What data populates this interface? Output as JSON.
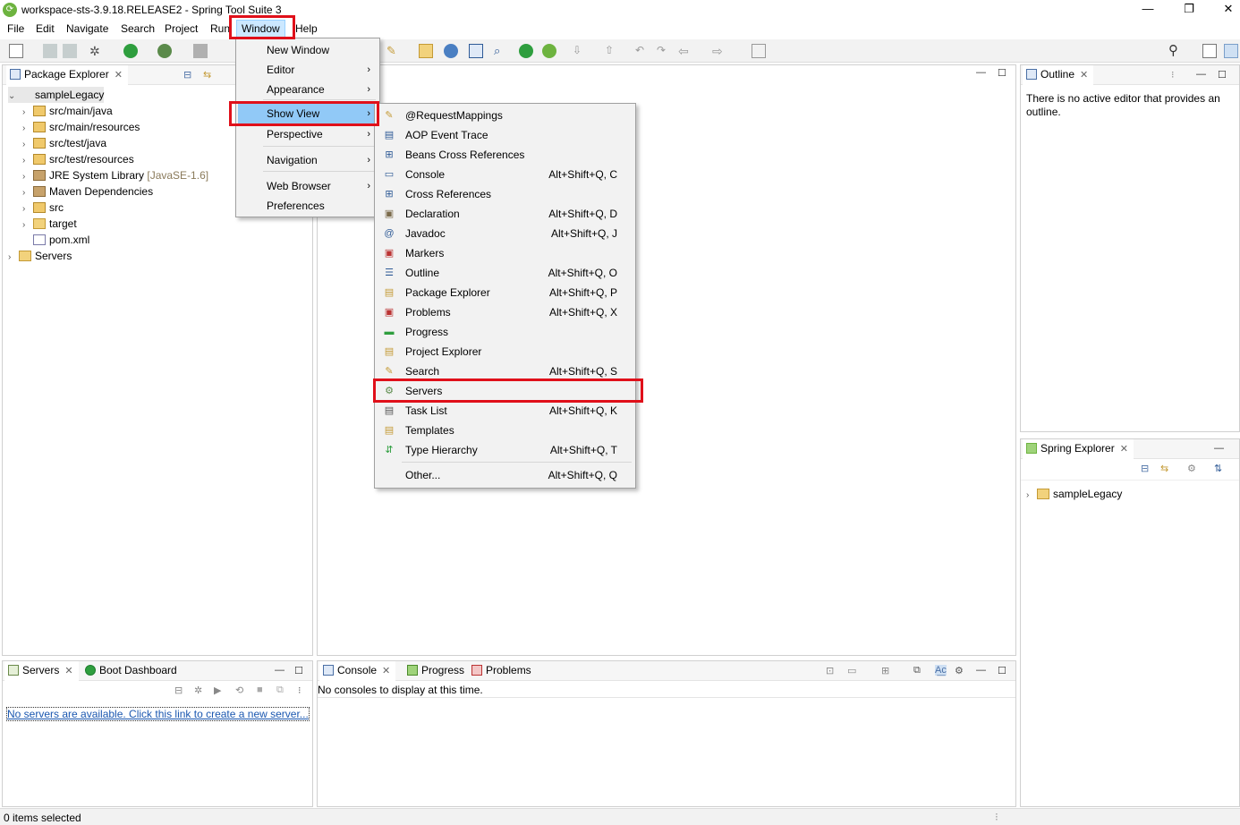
{
  "window": {
    "title": "workspace-sts-3.9.18.RELEASE2 - Spring Tool Suite 3",
    "minimize": "—",
    "restore": "❐",
    "close": "✕"
  },
  "menubar": {
    "items": [
      "File",
      "Edit",
      "Navigate",
      "Search",
      "Project",
      "Run",
      "Window",
      "Help"
    ],
    "active": "Window"
  },
  "window_menu": {
    "items": [
      {
        "label": "New Window"
      },
      {
        "label": "Editor",
        "submenu": true
      },
      {
        "label": "Appearance",
        "submenu": true
      },
      {
        "label": "Show View",
        "submenu": true,
        "highlighted": true
      },
      {
        "label": "Perspective",
        "submenu": true
      },
      {
        "label": "Navigation",
        "submenu": true
      },
      {
        "label": "Web Browser",
        "submenu": true
      },
      {
        "label": "Preferences"
      }
    ]
  },
  "show_view_menu": {
    "items": [
      {
        "label": "@RequestMappings",
        "accel": "",
        "icon": "request-mapping-icon"
      },
      {
        "label": "AOP Event Trace",
        "accel": "",
        "icon": "aop-icon"
      },
      {
        "label": "Beans Cross References",
        "accel": "",
        "icon": "beans-icon"
      },
      {
        "label": "Console",
        "accel": "Alt+Shift+Q, C",
        "icon": "console-icon"
      },
      {
        "label": "Cross References",
        "accel": "",
        "icon": "cross-ref-icon"
      },
      {
        "label": "Declaration",
        "accel": "Alt+Shift+Q, D",
        "icon": "declaration-icon"
      },
      {
        "label": "Javadoc",
        "accel": "Alt+Shift+Q, J",
        "icon": "javadoc-icon"
      },
      {
        "label": "Markers",
        "accel": "",
        "icon": "markers-icon"
      },
      {
        "label": "Outline",
        "accel": "Alt+Shift+Q, O",
        "icon": "outline-icon"
      },
      {
        "label": "Package Explorer",
        "accel": "Alt+Shift+Q, P",
        "icon": "package-explorer-icon"
      },
      {
        "label": "Problems",
        "accel": "Alt+Shift+Q, X",
        "icon": "problems-icon"
      },
      {
        "label": "Progress",
        "accel": "",
        "icon": "progress-icon"
      },
      {
        "label": "Project Explorer",
        "accel": "",
        "icon": "project-explorer-icon"
      },
      {
        "label": "Search",
        "accel": "Alt+Shift+Q, S",
        "icon": "search-icon"
      },
      {
        "label": "Servers",
        "accel": "",
        "icon": "servers-icon",
        "highlighted_box": true
      },
      {
        "label": "Task List",
        "accel": "Alt+Shift+Q, K",
        "icon": "task-list-icon"
      },
      {
        "label": "Templates",
        "accel": "",
        "icon": "templates-icon"
      },
      {
        "label": "Type Hierarchy",
        "accel": "Alt+Shift+Q, T",
        "icon": "type-hierarchy-icon"
      },
      {
        "label": "Other...",
        "accel": "Alt+Shift+Q, Q",
        "icon": ""
      }
    ]
  },
  "package_explorer": {
    "tab": "Package Explorer",
    "tree": [
      {
        "label": "sampleLegacy",
        "depth": 0,
        "expanded": true,
        "icon": "project"
      },
      {
        "label": "src/main/java",
        "depth": 1,
        "icon": "pkg"
      },
      {
        "label": "src/main/resources",
        "depth": 1,
        "icon": "pkg"
      },
      {
        "label": "src/test/java",
        "depth": 1,
        "icon": "pkg"
      },
      {
        "label": "src/test/resources",
        "depth": 1,
        "icon": "pkg"
      },
      {
        "label": "JRE System Library",
        "decor": "[JavaSE-1.6]",
        "depth": 1,
        "icon": "lib"
      },
      {
        "label": "Maven Dependencies",
        "depth": 1,
        "icon": "lib"
      },
      {
        "label": "src",
        "depth": 1,
        "icon": "pkg"
      },
      {
        "label": "target",
        "depth": 1,
        "icon": "fold"
      },
      {
        "label": "pom.xml",
        "depth": 1,
        "icon": "xml",
        "leaf": true
      },
      {
        "label": "Servers",
        "depth": 0,
        "icon": "fold"
      }
    ]
  },
  "outline": {
    "tab": "Outline",
    "message": "There is no active editor that provides an outline."
  },
  "spring_explorer": {
    "tab": "Spring Explorer",
    "tree": [
      {
        "label": "sampleLegacy"
      }
    ]
  },
  "servers_view": {
    "tabs": [
      "Servers",
      "Boot Dashboard"
    ],
    "link": "No servers are available. Click this link to create a new server..."
  },
  "console_view": {
    "tabs": [
      "Console",
      "Progress",
      "Problems"
    ],
    "message": "No consoles to display at this time."
  },
  "status": {
    "text": "0 items selected"
  },
  "colors": {
    "highlight_box": "#e0101a",
    "menu_selection": "#91c9f7",
    "link": "#1a57b0"
  }
}
